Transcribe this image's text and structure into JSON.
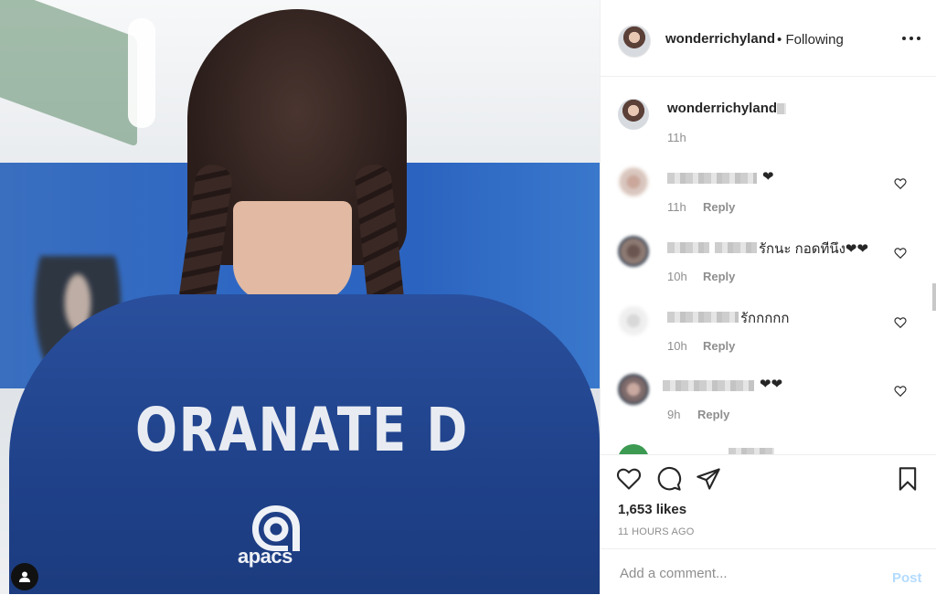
{
  "photo": {
    "jersey_name": "ORANATE D",
    "brand": "apacs"
  },
  "post": {
    "author": "wonderrichyland",
    "separator": "•",
    "follow_state": "Following",
    "likes": "1,653 likes",
    "time_ago": "11 HOURS AGO"
  },
  "caption": {
    "author": "wonderrichyland",
    "time": "11h"
  },
  "comments": [
    {
      "text": "❤",
      "time": "11h",
      "reply_label": "Reply"
    },
    {
      "text": "รักนะ กอดทีนึง❤❤",
      "time": "10h",
      "reply_label": "Reply"
    },
    {
      "text": "รักกกกก",
      "time": "10h",
      "reply_label": "Reply"
    },
    {
      "text": "❤❤",
      "time": "9h",
      "reply_label": "Reply"
    }
  ],
  "comment_box": {
    "placeholder": "Add a comment...",
    "post_label": "Post"
  },
  "colors": {
    "text": "#262626",
    "muted": "#8e8e8e",
    "post_disabled": "#b3dbff",
    "shirt": "#1f4189"
  },
  "icons": [
    "more-icon",
    "heart-icon",
    "comment-icon",
    "share-icon",
    "bookmark-icon",
    "user-tag-icon",
    "like-comment-icon"
  ]
}
